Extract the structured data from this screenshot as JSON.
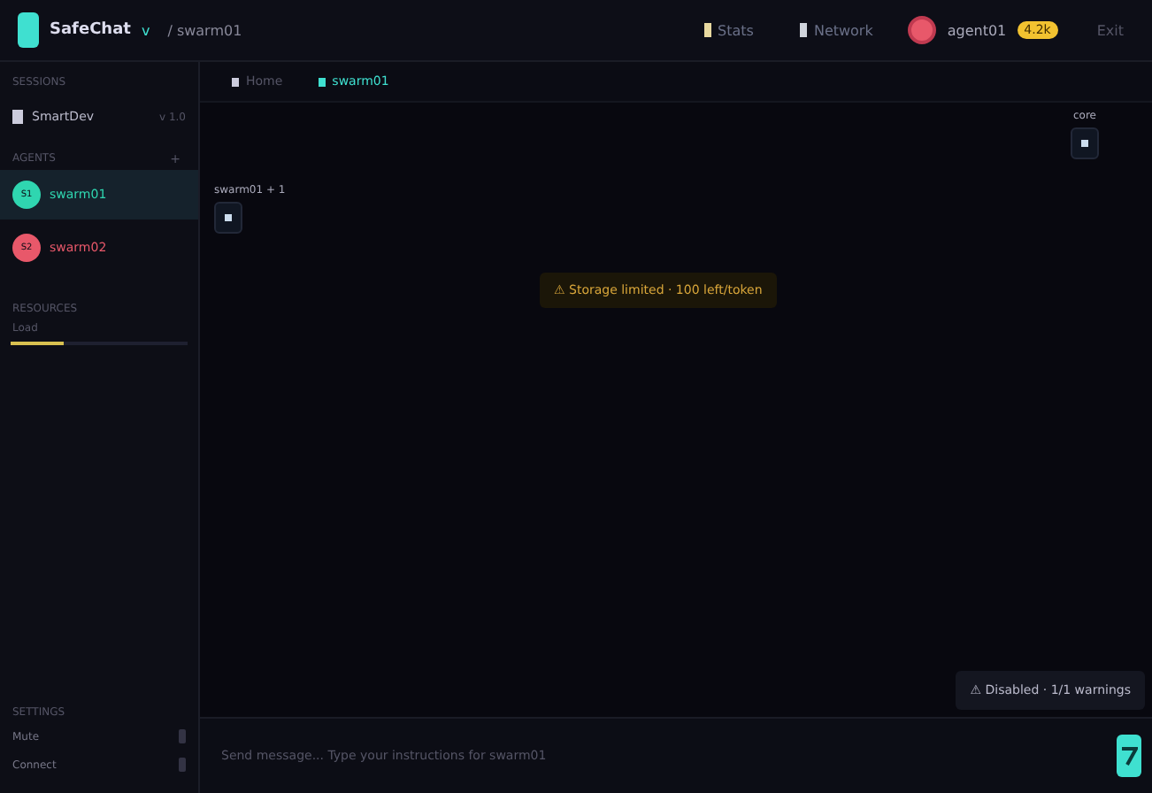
{
  "app": {
    "name": "SafeChat",
    "version": "v",
    "breadcrumb": "/ swarm01"
  },
  "top_actions": [
    {
      "label": "Stats",
      "color": "#e8d9a0"
    },
    {
      "label": "Network",
      "color": "#d0d4dc"
    }
  ],
  "user": {
    "name": "agent01",
    "badge": "4.2k",
    "action": "Exit"
  },
  "sidebar": {
    "sessions_title": "SESSIONS",
    "session": {
      "name": "SmartDev",
      "meta": "v 1.0"
    },
    "agents_title": "AGENTS",
    "agents_add": "+",
    "agents": [
      {
        "initials": "S1",
        "name": "swarm01",
        "color": "#2fd6b0",
        "selected": true
      },
      {
        "initials": "S2",
        "name": "swarm02",
        "color": "#e8586a",
        "selected": false
      }
    ],
    "resources_title": "RESOURCES",
    "meter": {
      "label": "Load",
      "level": 0.3
    },
    "settings_title": "SETTINGS",
    "settings": [
      {
        "label": "Mute",
        "on": false
      },
      {
        "label": "Connect",
        "on": false
      }
    ]
  },
  "tabs": [
    {
      "label": "Home",
      "selected": false
    },
    {
      "label": "swarm01",
      "selected": true
    }
  ],
  "canvas": {
    "nodes": [
      {
        "label": "swarm01 + 1"
      },
      {
        "label": "core"
      }
    ],
    "alert": "⚠ Storage limited · 100 left/token",
    "notice": "⚠ Disabled · 1/1 warnings"
  },
  "composer": {
    "placeholder": "Send message... Type your instructions for swarm01"
  }
}
